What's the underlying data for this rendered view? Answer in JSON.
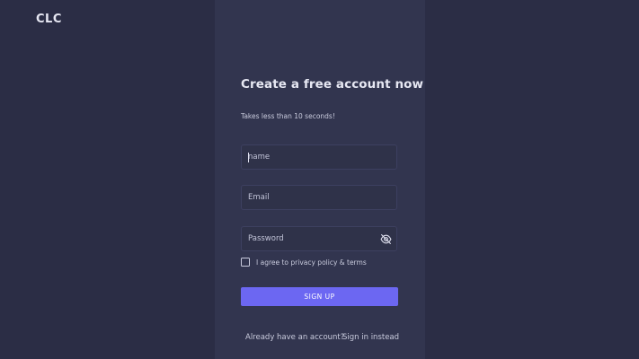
{
  "brand": {
    "logo_text": "CLC"
  },
  "form": {
    "title": "Create a free account now",
    "subtitle": "Takes less than 10 seconds!",
    "name_placeholder": "name",
    "email_placeholder": "Email",
    "password_placeholder": "Password",
    "password_toggle_icon": "eye-off-icon",
    "agree_label": "I agree to privacy policy & terms",
    "agree_checked": false,
    "submit_label": "SIGN UP",
    "signin_prompt": "Already have an account?",
    "signin_link": "Sign in instead"
  },
  "colors": {
    "background": "#2b2d45",
    "panel": "#32354f",
    "accent": "#6c67f2"
  }
}
